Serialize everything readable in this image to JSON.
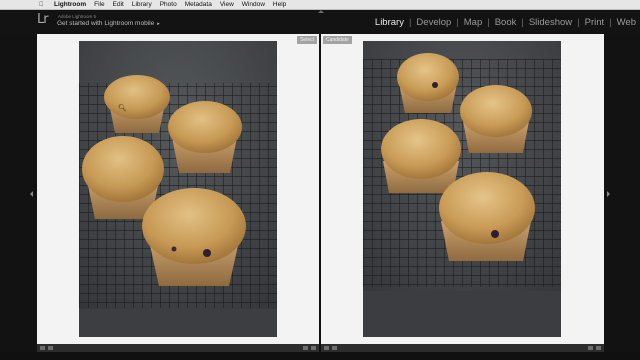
{
  "menubar": {
    "apple_icon": "apple-icon",
    "app_name": "Lightroom",
    "items": [
      "File",
      "Edit",
      "Library",
      "Photo",
      "Metadata",
      "View",
      "Window",
      "Help"
    ]
  },
  "identity": {
    "logo": "Lr",
    "product": "Adobe Lightroom 5",
    "plate": "Get started with Lightroom mobile",
    "caret": "▸"
  },
  "modules": [
    {
      "label": "Library",
      "active": true
    },
    {
      "label": "Develop",
      "active": false
    },
    {
      "label": "Map",
      "active": false
    },
    {
      "label": "Book",
      "active": false
    },
    {
      "label": "Slideshow",
      "active": false
    },
    {
      "label": "Print",
      "active": false
    },
    {
      "label": "Web",
      "active": false
    }
  ],
  "compare": {
    "select_label": "Select",
    "candidate_label": "Candidate"
  },
  "colors": {
    "panel_bg": "#f3f3f3",
    "menubar_bg": "#e6e6e6",
    "app_bg": "#121212",
    "active_module": "#e8e8e8",
    "inactive_module": "#9a9a9a"
  }
}
